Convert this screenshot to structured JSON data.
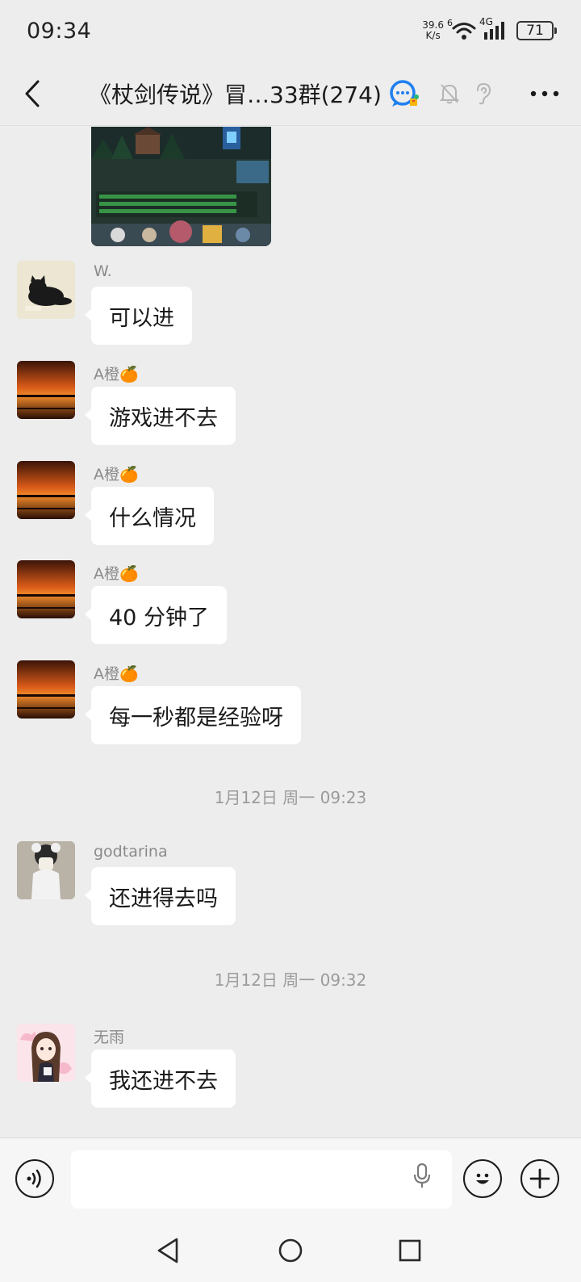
{
  "status_bar": {
    "time": "09:34",
    "net_speed_value": "39.6",
    "net_speed_unit": "K/s",
    "wifi_badge": "6",
    "cell_label": "4G",
    "battery": "71"
  },
  "header": {
    "title": "《杖剑传说》冒…33群(274)",
    "icons": [
      "back-arrow-icon",
      "group-chat-icon",
      "mute-bell-icon",
      "earpiece-icon",
      "more-icon"
    ]
  },
  "messages": [
    {
      "sender": "W.",
      "text": "可以进",
      "avatar": "black-cat"
    },
    {
      "sender": "A橙🍊",
      "text": "游戏进不去",
      "avatar": "sunset"
    },
    {
      "sender": "A橙🍊",
      "text": "什么情况",
      "avatar": "sunset"
    },
    {
      "sender": "A橙🍊",
      "text": "40 分钟了",
      "avatar": "sunset"
    },
    {
      "sender": "A橙🍊",
      "text": "每一秒都是经验呀",
      "avatar": "sunset"
    },
    {
      "sender": "godtarina",
      "text": "还进得去吗",
      "avatar": "plush-figure"
    },
    {
      "sender": "无雨",
      "text": "我还进不去",
      "avatar": "anime-girl"
    }
  ],
  "timestamps": [
    "1月12日 周一 09:23",
    "1月12日 周一 09:32"
  ],
  "colors": {
    "background": "#ededed",
    "bubble": "#ffffff",
    "meta_text": "#8a8a8a"
  }
}
